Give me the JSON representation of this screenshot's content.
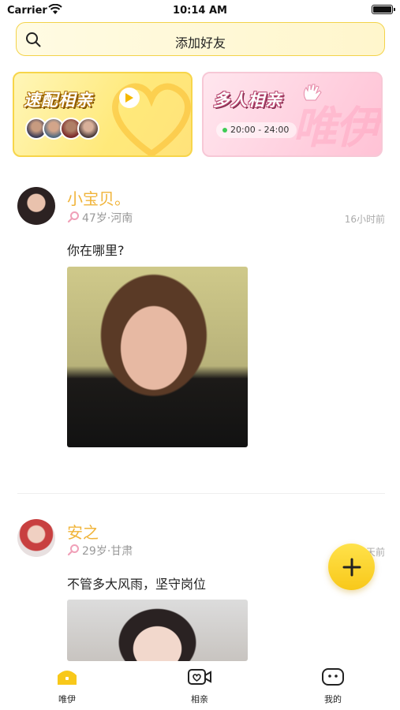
{
  "status_bar": {
    "carrier": "Carrier",
    "time": "10:14 AM"
  },
  "search": {
    "label": "添加好友"
  },
  "banners": {
    "speed": {
      "title": "速配相亲"
    },
    "multi": {
      "title": "多人相亲",
      "time_range": "20:00 - 24:00"
    }
  },
  "posts": [
    {
      "name": "小宝贝。",
      "meta": "47岁·河南",
      "time": "16小时前",
      "text": "你在哪里?"
    },
    {
      "name": "安之",
      "meta": "29岁·甘肃",
      "time": "天前",
      "text": "不管多大风雨，坚守岗位"
    }
  ],
  "tabs": [
    {
      "label": "唯伊"
    },
    {
      "label": "相亲"
    },
    {
      "label": "我的"
    }
  ],
  "colors": {
    "accent": "#f0b43a",
    "fab": "#f8c81a",
    "search_border": "#f3d34a"
  }
}
